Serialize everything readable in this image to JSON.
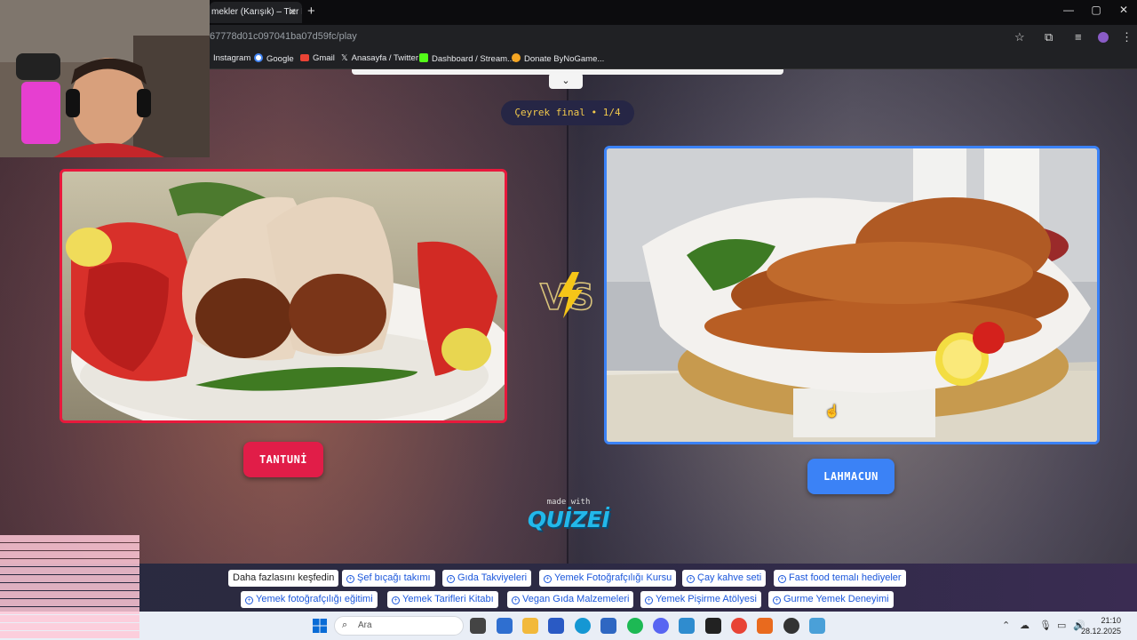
{
  "browser": {
    "tab_title": "mekler (Karışık) – Tier L",
    "tab_close": "✕",
    "new_tab": "+",
    "url": "67778d01c097041ba07d59fc/play",
    "window_controls": [
      "—",
      "▢",
      "✕"
    ],
    "bookmarks": [
      {
        "label": "Instagram",
        "icon_color": ""
      },
      {
        "label": "Google",
        "icon_color": "#4285f4"
      },
      {
        "label": "Gmail",
        "icon_color": "#ea4335"
      },
      {
        "label": "Anasayfa / Twitter",
        "icon_color": "#000000"
      },
      {
        "label": "Dashboard / Stream...",
        "icon_color": "#53fc18"
      },
      {
        "label": "Donate ByNoGame...",
        "icon_color": "#f5a623"
      }
    ]
  },
  "game": {
    "round_label": "Çeyrek final • 1/4",
    "collapse_icon": "chevron-down-icon",
    "left": {
      "name": "TANTUNİ",
      "image_alt": "Tantuni wraps on a plate with tomatoes and peppers",
      "accent": "#e11d48"
    },
    "right": {
      "name": "LAHMACUN",
      "image_alt": "Stack of lahmacun with lemon and tomato",
      "accent": "#3b82f6"
    },
    "vs_label": "VS",
    "made_with": "made with",
    "brand": "QUİZEİ"
  },
  "ads": {
    "row1": [
      "Daha fazlasını keşfedin",
      "Şef bıçağı takımı",
      "Gıda Takviyeleri",
      "Yemek Fotoğrafçılığı Kursu",
      "Çay kahve seti",
      "Fast food temalı hediyeler"
    ],
    "row2": [
      "Yemek fotoğrafçılığı eğitimi",
      "Yemek Tarifleri Kitabı",
      "Vegan Gıda Malzemeleri",
      "Yemek Pişirme Atölyesi",
      "Gurme Yemek Deneyimi"
    ]
  },
  "taskbar": {
    "search_label": "Ara",
    "time": "21:10",
    "date": "28.12.2025"
  },
  "colors": {
    "left_accent": "#e11d48",
    "right_accent": "#3b82f6",
    "round_text": "#f2c94c",
    "brand": "#22b8ea"
  }
}
